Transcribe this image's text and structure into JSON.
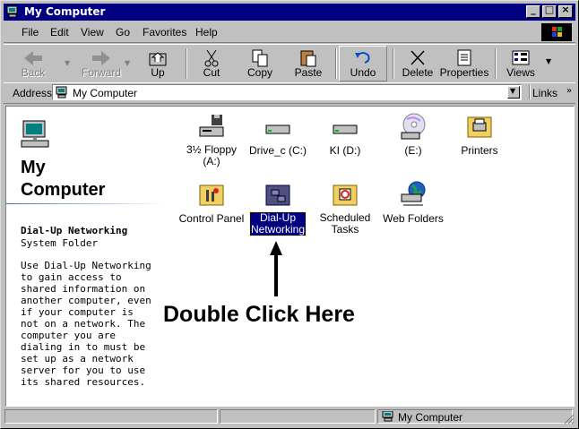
{
  "window": {
    "title": "My Computer"
  },
  "titlebar_buttons": {
    "minimize": "_",
    "maximize": "□",
    "close": "×"
  },
  "menu": [
    "File",
    "Edit",
    "View",
    "Go",
    "Favorites",
    "Help"
  ],
  "toolbar": {
    "back": "Back",
    "forward": "Forward",
    "up": "Up",
    "cut": "Cut",
    "copy": "Copy",
    "paste": "Paste",
    "undo": "Undo",
    "delete": "Delete",
    "properties": "Properties",
    "views": "Views"
  },
  "address": {
    "label": "Address",
    "value": "My Computer",
    "links": "Links"
  },
  "leftpane": {
    "title_line1": "My",
    "title_line2": "Computer",
    "selected_name": "Dial-Up Networking",
    "selected_type": "System Folder",
    "description": "Use Dial-Up Networking to gain access to shared information on another computer, even if your computer is not on a network. The computer you are dialing in to must be set up as a network server for you to use its shared resources."
  },
  "items": {
    "floppy": "3½ Floppy (A:)",
    "drive_c": "Drive_c (C:)",
    "drive_d": "KI (D:)",
    "drive_e": "(E:)",
    "printers": "Printers",
    "control_panel": "Control Panel",
    "dialup_line1": "Dial-Up",
    "dialup_line2": "Networking",
    "sched_line1": "Scheduled",
    "sched_line2": "Tasks",
    "web_folders": "Web Folders"
  },
  "annotation": "Double Click Here",
  "status": {
    "zone": "My Computer"
  },
  "colors": {
    "titlebar": "#000080",
    "face": "#c0c0c0",
    "selection": "#000080"
  }
}
